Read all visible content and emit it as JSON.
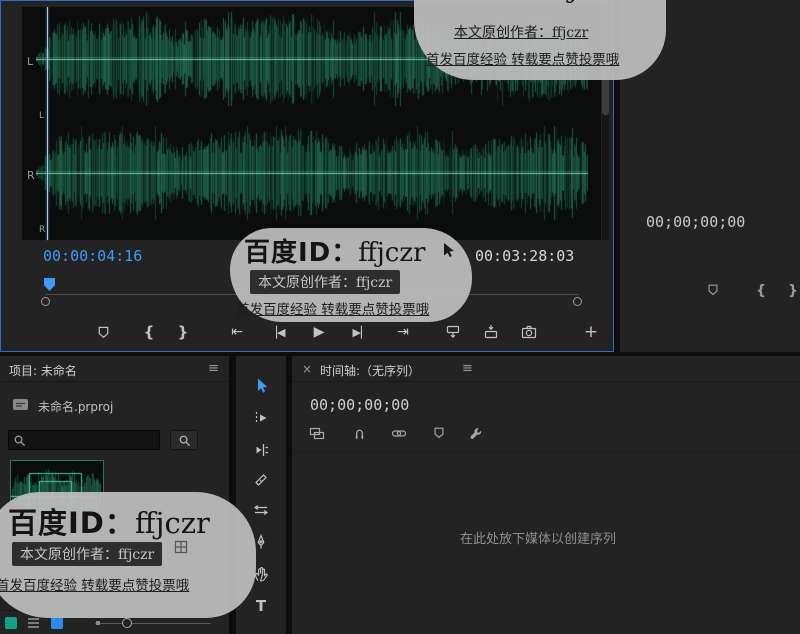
{
  "source_monitor": {
    "current_timecode": "00:00:04:16",
    "duration_timecode": "00:03:28:03",
    "left_channel_label": "L",
    "right_channel_label": "R",
    "left_channel_small": "L",
    "right_channel_small": "R",
    "transport": {
      "mark_in": "{",
      "mark_out": "}",
      "go_to_in": "⇤",
      "step_back": "▕◀",
      "play": "▶",
      "step_forward": "▶▏",
      "go_to_out": "⇥",
      "button_editor": "+"
    }
  },
  "program_monitor": {
    "timecode": "00;00;00;00",
    "mark_in": "{",
    "mark_out": "}"
  },
  "project_panel": {
    "title": "项目: 未命名",
    "menu_icon": "≡",
    "file_name": "未命名.prproj",
    "search_placeholder": ""
  },
  "timeline_panel": {
    "close_icon": "×",
    "title": "时间轴:（无序列）",
    "menu_icon": "≡",
    "timecode": "00;00;00;00",
    "empty_message": "在此处放下媒体以创建序列"
  },
  "watermark": {
    "id_prefix": "百度ID：",
    "id_value": "ffjczr",
    "author_line": "本文原创作者：ffjczr",
    "slogan_line": "首发百度经验 转载要点赞投票哦"
  },
  "colors": {
    "accent_blue": "#2d8ceb",
    "timecode_blue": "#3f9bfa",
    "wave_green": "#1c7a57",
    "panel_bg": "#232323"
  }
}
